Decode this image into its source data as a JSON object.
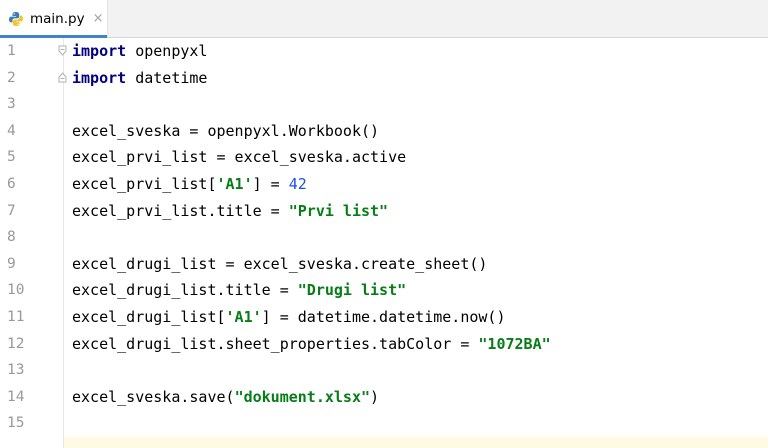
{
  "tab": {
    "label": "main.py",
    "close": "×",
    "icon": "python-file-icon"
  },
  "colors": {
    "keyword": "#000080",
    "string": "#067d17",
    "number": "#1750eb",
    "line_number": "#999999",
    "tab_underline": "#4083c9"
  },
  "lines": [
    {
      "num": "1",
      "parts": [
        {
          "t": "import",
          "c": "kw"
        },
        {
          "t": " openpyxl",
          "c": ""
        }
      ]
    },
    {
      "num": "2",
      "parts": [
        {
          "t": "import",
          "c": "kw"
        },
        {
          "t": " datetime",
          "c": ""
        }
      ]
    },
    {
      "num": "3",
      "parts": []
    },
    {
      "num": "4",
      "parts": [
        {
          "t": "excel_sveska = openpyxl.Workbook()",
          "c": ""
        }
      ]
    },
    {
      "num": "5",
      "parts": [
        {
          "t": "excel_prvi_list = excel_sveska.active",
          "c": ""
        }
      ]
    },
    {
      "num": "6",
      "parts": [
        {
          "t": "excel_prvi_list[",
          "c": ""
        },
        {
          "t": "'A1'",
          "c": "str"
        },
        {
          "t": "] = ",
          "c": ""
        },
        {
          "t": "42",
          "c": "num"
        }
      ]
    },
    {
      "num": "7",
      "parts": [
        {
          "t": "excel_prvi_list.title = ",
          "c": ""
        },
        {
          "t": "\"Prvi list\"",
          "c": "str"
        }
      ]
    },
    {
      "num": "8",
      "parts": []
    },
    {
      "num": "9",
      "parts": [
        {
          "t": "excel_drugi_list = excel_sveska.create_sheet()",
          "c": ""
        }
      ]
    },
    {
      "num": "10",
      "parts": [
        {
          "t": "excel_drugi_list.title = ",
          "c": ""
        },
        {
          "t": "\"Drugi list\"",
          "c": "str"
        }
      ]
    },
    {
      "num": "11",
      "parts": [
        {
          "t": "excel_drugi_list[",
          "c": ""
        },
        {
          "t": "'A1'",
          "c": "str"
        },
        {
          "t": "] = datetime.datetime.now()",
          "c": ""
        }
      ]
    },
    {
      "num": "12",
      "parts": [
        {
          "t": "excel_drugi_list.sheet_properties.tabColor = ",
          "c": ""
        },
        {
          "t": "\"1072BA\"",
          "c": "str"
        }
      ]
    },
    {
      "num": "13",
      "parts": []
    },
    {
      "num": "14",
      "parts": [
        {
          "t": "excel_sveska.save(",
          "c": ""
        },
        {
          "t": "\"dokument.xlsx\"",
          "c": "str"
        },
        {
          "t": ")",
          "c": ""
        }
      ]
    },
    {
      "num": "15",
      "parts": []
    }
  ]
}
